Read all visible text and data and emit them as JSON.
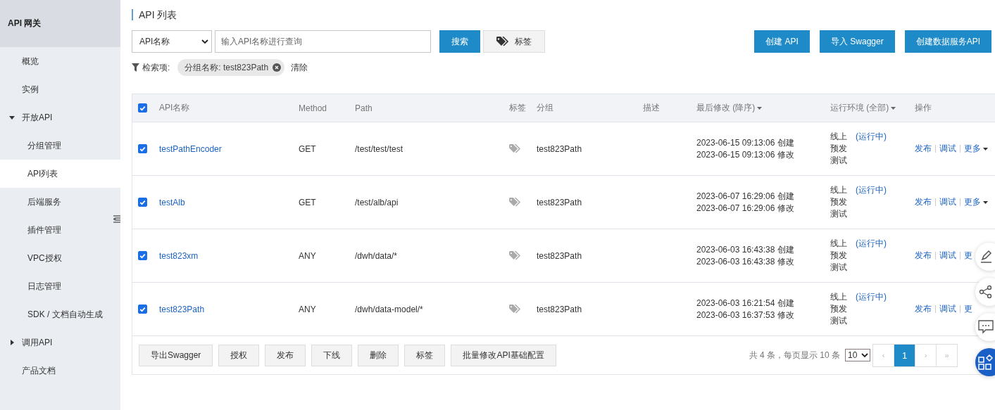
{
  "sidebar": {
    "title": "API 网关",
    "items": [
      {
        "label": "概览",
        "selected": false
      },
      {
        "label": "实例",
        "selected": false
      },
      {
        "label": "开放API",
        "selected": false,
        "expanded": true,
        "children": [
          {
            "label": "分组管理",
            "selected": false
          },
          {
            "label": "API列表",
            "selected": true
          },
          {
            "label": "后端服务",
            "selected": false
          },
          {
            "label": "插件管理",
            "selected": false
          },
          {
            "label": "VPC授权",
            "selected": false
          },
          {
            "label": "日志管理",
            "selected": false
          },
          {
            "label": "SDK / 文档自动生成",
            "selected": false
          }
        ]
      },
      {
        "label": "调用API",
        "selected": false,
        "expanded": false
      },
      {
        "label": "产品文档",
        "selected": false
      }
    ]
  },
  "page_title": "API 列表",
  "search": {
    "field_select": "API名称",
    "placeholder": "输入API名称进行查询",
    "search_button": "搜索",
    "tag_button": "标签"
  },
  "actions": [
    "创建 API",
    "导入 Swagger",
    "创建数据服务API"
  ],
  "filter": {
    "label": "检索项:",
    "chips": [
      "分组名称: test823Path"
    ],
    "clear": "清除"
  },
  "table": {
    "select_all": {
      "checked": true
    },
    "columns": [
      "API名称",
      "Method",
      "Path",
      "标签",
      "分组",
      "描述",
      "最后修改 (降序)",
      "运行环境 (全部)",
      "操作"
    ],
    "rows": [
      {
        "checked": true,
        "name": "testPathEncoder",
        "method": "GET",
        "path": "/test/test/test",
        "group": "test823Path",
        "created": "2023-06-15 09:13:06 创建",
        "modified": "2023-06-15 09:13:06 修改",
        "envs": [
          "线上",
          "预发",
          "测试"
        ],
        "env_status": "(运行中)",
        "ops": [
          "发布",
          "调试",
          "更多"
        ],
        "more_caret": true
      },
      {
        "checked": true,
        "name": "testAlb",
        "method": "GET",
        "path": "/test/alb/api",
        "group": "test823Path",
        "created": "2023-06-07 16:29:06 创建",
        "modified": "2023-06-07 16:29:06 修改",
        "envs": [
          "线上",
          "预发",
          "测试"
        ],
        "env_status": "(运行中)",
        "ops": [
          "发布",
          "调试",
          "更多"
        ],
        "more_caret": true
      },
      {
        "checked": true,
        "name": "test823xm",
        "method": "ANY",
        "path": "/dwh/data/*",
        "group": "test823Path",
        "created": "2023-06-03 16:43:38 创建",
        "modified": "2023-06-03 16:43:38 修改",
        "envs": [
          "线上",
          "预发",
          "测试"
        ],
        "env_status": "(运行中)",
        "ops": [
          "发布",
          "调试",
          "更"
        ],
        "more_caret": false
      },
      {
        "checked": true,
        "name": "test823Path",
        "method": "ANY",
        "path": "/dwh/data-model/*",
        "group": "test823Path",
        "created": "2023-06-03 16:21:54 创建",
        "modified": "2023-06-03 16:37:53 修改",
        "envs": [
          "线上",
          "预发",
          "测试"
        ],
        "env_status": "(运行中)",
        "ops": [
          "发布",
          "调试",
          "更"
        ],
        "more_caret": false
      }
    ],
    "bulk_buttons": [
      "导出Swagger",
      "授权",
      "发布",
      "下线",
      "删除",
      "标签",
      "批量修改API基础配置"
    ],
    "summary": "共 4 条，每页显示 10 条",
    "page_size": "10",
    "pages": [
      {
        "label": "‹",
        "selected": false
      },
      {
        "label": "1",
        "selected": true
      },
      {
        "label": "›",
        "selected": false
      },
      {
        "label": "»",
        "selected": false
      }
    ]
  }
}
